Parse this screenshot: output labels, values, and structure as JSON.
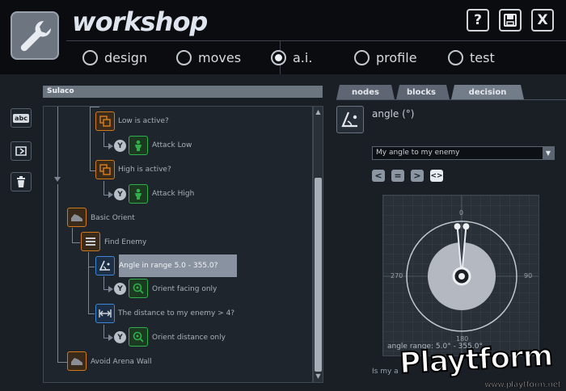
{
  "app": {
    "title": "workshop"
  },
  "header": {
    "buttons": {
      "help": "?",
      "save": "save",
      "close": "X"
    },
    "nav": [
      {
        "label": "design",
        "selected": false
      },
      {
        "label": "moves",
        "selected": false
      },
      {
        "label": "a.i.",
        "selected": true
      },
      {
        "label": "profile",
        "selected": false
      },
      {
        "label": "test",
        "selected": false
      }
    ]
  },
  "sidebar": {
    "tools": [
      "abc",
      "rename",
      "delete"
    ]
  },
  "tree": {
    "title": "Sulaco",
    "nodes": [
      {
        "label": "Low is active?",
        "kind": "condition",
        "color": "orange",
        "icon": "copy-icon"
      },
      {
        "label": "Attack Low",
        "kind": "action",
        "color": "green",
        "icon": "figure-icon",
        "badge": "Y"
      },
      {
        "label": "High is active?",
        "kind": "condition",
        "color": "orange",
        "icon": "copy-icon"
      },
      {
        "label": "Attack High",
        "kind": "action",
        "color": "green",
        "icon": "figure-icon",
        "badge": "Y"
      },
      {
        "label": "Basic Orient",
        "kind": "group",
        "color": "orange",
        "icon": "shoe-icon"
      },
      {
        "label": "Find Enemy",
        "kind": "sequence",
        "color": "orange",
        "icon": "list-icon"
      },
      {
        "label": "Angle in range 5.0 - 355.0?",
        "kind": "decision",
        "color": "blue",
        "icon": "angle-icon",
        "selected": true
      },
      {
        "label": "Orient facing only",
        "kind": "action",
        "color": "green",
        "icon": "target-icon",
        "badge": "Y"
      },
      {
        "label": "The distance to my enemy > 4?",
        "kind": "decision",
        "color": "blue",
        "icon": "distance-icon"
      },
      {
        "label": "Orient distance only",
        "kind": "action",
        "color": "green",
        "icon": "target-icon",
        "badge": "Y"
      },
      {
        "label": "Avoid Arena Wall",
        "kind": "group",
        "color": "orange",
        "icon": "shoe-icon"
      }
    ]
  },
  "right_panel": {
    "tabs": [
      {
        "label": "nodes",
        "selected": false
      },
      {
        "label": "blocks",
        "selected": false
      },
      {
        "label": "decision",
        "selected": true
      }
    ],
    "decision": {
      "title": "angle (°)",
      "select_value": "My angle to my enemy",
      "comparators": [
        "<",
        "=",
        ">",
        "<>"
      ],
      "active_comparator": "<>",
      "dial": {
        "labels": {
          "top": "0",
          "left": "270",
          "right": "90",
          "bottom": "180"
        },
        "range_min": 5.0,
        "range_max": 355.0,
        "range_text": "angle range: 5.0° - 355.0°"
      },
      "footer_text": "Is my a"
    }
  },
  "watermark": {
    "logo": "Playtform",
    "url": "www.playtform.net"
  },
  "colors": {
    "accent_orange": "#d27a1a",
    "accent_green": "#2fb04b",
    "accent_blue": "#3c87d6",
    "background": "#1a1f26"
  }
}
